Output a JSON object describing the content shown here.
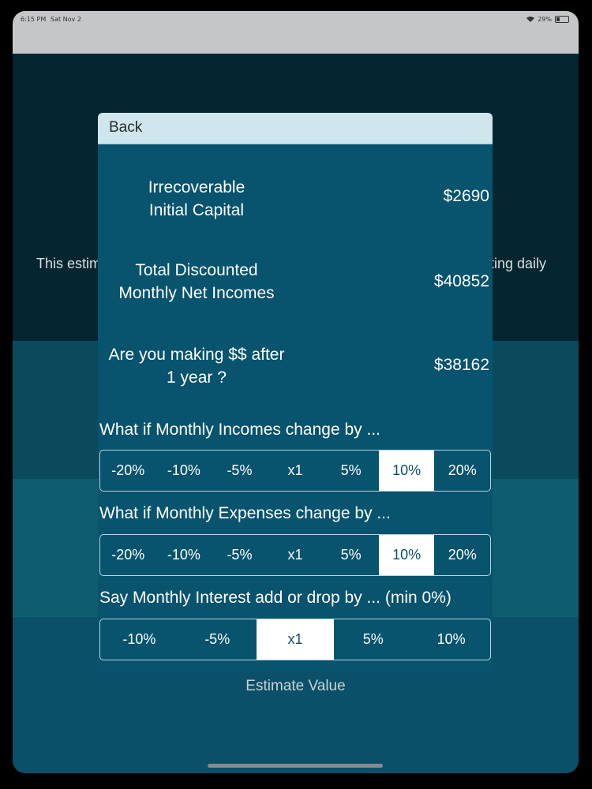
{
  "status_bar": {
    "time": "6:15 PM",
    "date": "Sat Nov 2",
    "battery": "29%",
    "battery_level": 0.29
  },
  "background": {
    "text_left": "This estim",
    "text_right": "ting daily",
    "estimate_label": "Estimate Value"
  },
  "modal": {
    "back_label": "Back",
    "metrics": [
      {
        "label_line1": "Irrecoverable",
        "label_line2": "Initial Capital",
        "value": "$2690"
      },
      {
        "label_line1": "Total Discounted",
        "label_line2": "Monthly Net Incomes",
        "value": "$40852"
      },
      {
        "label_line1": "Are you making $$ after",
        "label_line2": "1 year ?",
        "value": "$38162"
      }
    ],
    "incomes": {
      "title": "What if Monthly Incomes change by ...",
      "options": [
        "-20%",
        "-10%",
        "-5%",
        "x1",
        "5%",
        "10%",
        "20%"
      ],
      "selected": "10%"
    },
    "expenses": {
      "title": "What if Monthly Expenses change by ...",
      "options": [
        "-20%",
        "-10%",
        "-5%",
        "x1",
        "5%",
        "10%",
        "20%"
      ],
      "selected": "10%"
    },
    "interest": {
      "title": "Say Monthly Interest add or drop by ... (min 0%)",
      "options": [
        "-10%",
        "-5%",
        "x1",
        "5%",
        "10%"
      ],
      "selected": "x1"
    }
  }
}
